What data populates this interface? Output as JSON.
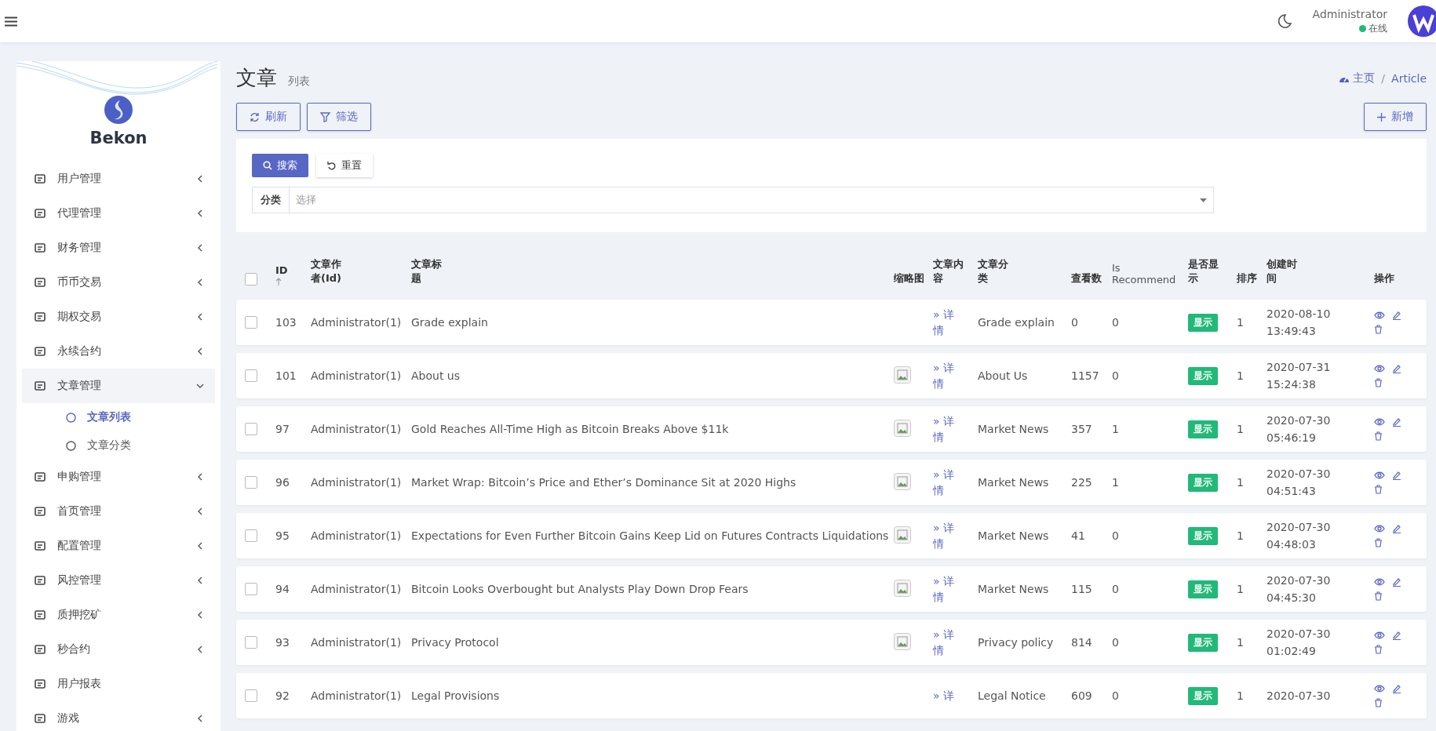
{
  "topbar": {
    "user_name": "Administrator",
    "status": "在线",
    "online": true
  },
  "sidebar": {
    "brand": "Bekon",
    "items": [
      {
        "label": "用户管理",
        "kind": "group",
        "expanded": false,
        "selected": false
      },
      {
        "label": "代理管理",
        "kind": "group",
        "expanded": false,
        "selected": false
      },
      {
        "label": "财务管理",
        "kind": "group",
        "expanded": false,
        "selected": false
      },
      {
        "label": "币币交易",
        "kind": "group",
        "expanded": false,
        "selected": false
      },
      {
        "label": "期权交易",
        "kind": "group",
        "expanded": false,
        "selected": false
      },
      {
        "label": "永续合约",
        "kind": "group",
        "expanded": false,
        "selected": false
      },
      {
        "label": "文章管理",
        "kind": "group",
        "expanded": true,
        "selected": true,
        "children": [
          {
            "label": "文章列表",
            "selected": true
          },
          {
            "label": "文章分类",
            "selected": false
          }
        ]
      },
      {
        "label": "申购管理",
        "kind": "group",
        "expanded": false,
        "selected": false
      },
      {
        "label": "首页管理",
        "kind": "group",
        "expanded": false,
        "selected": false
      },
      {
        "label": "配置管理",
        "kind": "group",
        "expanded": false,
        "selected": false
      },
      {
        "label": "风控管理",
        "kind": "group",
        "expanded": false,
        "selected": false
      },
      {
        "label": "质押挖矿",
        "kind": "group",
        "expanded": false,
        "selected": false
      },
      {
        "label": "秒合约",
        "kind": "group",
        "expanded": false,
        "selected": false
      },
      {
        "label": "用户报表",
        "kind": "link",
        "selected": false
      },
      {
        "label": "游戏",
        "kind": "group",
        "expanded": false,
        "selected": false
      }
    ]
  },
  "page": {
    "title": "文章",
    "subtitle": "列表",
    "breadcrumb": [
      "主页",
      "Article"
    ],
    "breadcrumb_separator": "/"
  },
  "toolbar": {
    "refresh": "刷新",
    "filter": "筛选",
    "add": "新增"
  },
  "filter_panel": {
    "search": "搜索",
    "reset": "重置",
    "category_label": "分类",
    "category_placeholder": "选择"
  },
  "table": {
    "all_checked": false,
    "columns": [
      "ID",
      "文章作者(Id)",
      "文章标题",
      "缩略图",
      "文章内容",
      "文章分类",
      "查看数",
      "Is Recommend",
      "是否显示",
      "排序",
      "创建时间",
      "操作"
    ],
    "rows": [
      {
        "checked": false,
        "id": "103",
        "author": "Administrator(1)",
        "title": "Grade explain",
        "thumbnail": false,
        "content": "» 详情",
        "category": "Grade explain",
        "views": "0",
        "recommend": "0",
        "display": "显示",
        "shown": true,
        "sort": "1",
        "created": [
          "2020-08-10",
          "13:49:43"
        ]
      },
      {
        "checked": false,
        "id": "101",
        "author": "Administrator(1)",
        "title": "About us",
        "thumbnail": true,
        "content": "» 详情",
        "category": "About Us",
        "views": "1157",
        "recommend": "0",
        "display": "显示",
        "shown": true,
        "sort": "1",
        "created": [
          "2020-07-31",
          "15:24:38"
        ]
      },
      {
        "checked": false,
        "id": "97",
        "author": "Administrator(1)",
        "title": "Gold Reaches All-Time High as Bitcoin Breaks Above $11k",
        "thumbnail": true,
        "content": "» 详情",
        "category": "Market News",
        "views": "357",
        "recommend": "1",
        "display": "显示",
        "shown": true,
        "sort": "1",
        "created": [
          "2020-07-30",
          "05:46:19"
        ]
      },
      {
        "checked": false,
        "id": "96",
        "author": "Administrator(1)",
        "title": "Market Wrap: Bitcoin’s Price and Ether’s Dominance Sit at 2020 Highs",
        "thumbnail": true,
        "content": "» 详情",
        "category": "Market News",
        "views": "225",
        "recommend": "1",
        "display": "显示",
        "shown": true,
        "sort": "1",
        "created": [
          "2020-07-30",
          "04:51:43"
        ]
      },
      {
        "checked": false,
        "id": "95",
        "author": "Administrator(1)",
        "title": "Expectations for Even Further Bitcoin Gains Keep Lid on Futures Contracts Liquidations",
        "thumbnail": true,
        "content": "» 详情",
        "category": "Market News",
        "views": "41",
        "recommend": "0",
        "display": "显示",
        "shown": true,
        "sort": "1",
        "created": [
          "2020-07-30",
          "04:48:03"
        ]
      },
      {
        "checked": false,
        "id": "94",
        "author": "Administrator(1)",
        "title": "Bitcoin Looks Overbought but Analysts Play Down Drop Fears",
        "thumbnail": true,
        "content": "» 详情",
        "category": "Market News",
        "views": "115",
        "recommend": "0",
        "display": "显示",
        "shown": true,
        "sort": "1",
        "created": [
          "2020-07-30",
          "04:45:30"
        ]
      },
      {
        "checked": false,
        "id": "93",
        "author": "Administrator(1)",
        "title": "Privacy Protocol",
        "thumbnail": true,
        "content": "» 详情",
        "category": "Privacy policy",
        "views": "814",
        "recommend": "0",
        "display": "显示",
        "shown": true,
        "sort": "1",
        "created": [
          "2020-07-30",
          "01:02:49"
        ]
      },
      {
        "checked": false,
        "id": "92",
        "author": "Administrator(1)",
        "title": "Legal Provisions",
        "thumbnail": false,
        "content": "» 详",
        "category": "Legal Notice",
        "views": "609",
        "recommend": "0",
        "display": "显示",
        "shown": true,
        "sort": "1",
        "created": [
          "2020-07-30"
        ]
      }
    ]
  }
}
